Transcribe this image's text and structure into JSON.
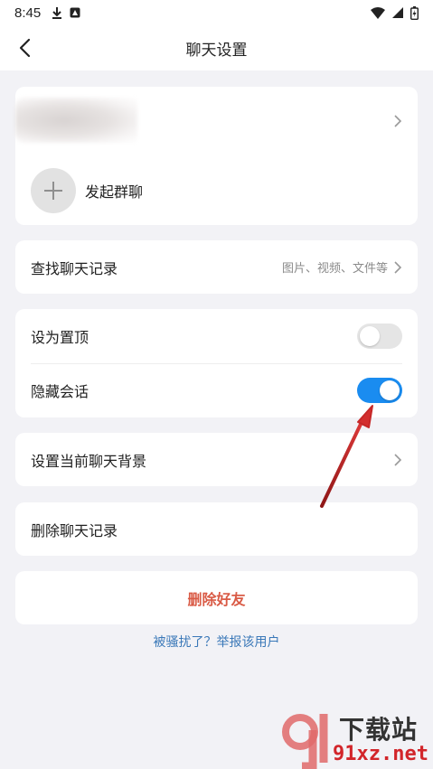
{
  "status_bar": {
    "time": "8:45"
  },
  "header": {
    "title": "聊天设置"
  },
  "group_section": {
    "start_group_label": "发起群聊"
  },
  "search_section": {
    "find_records_label": "查找聊天记录",
    "find_records_hint": "图片、视频、文件等"
  },
  "toggles_section": {
    "pin_label": "设为置顶",
    "pin_enabled": false,
    "hide_label": "隐藏会话",
    "hide_enabled": true
  },
  "background_section": {
    "set_background_label": "设置当前聊天背景"
  },
  "delete_records_section": {
    "delete_records_label": "删除聊天记录"
  },
  "danger_section": {
    "delete_friend_label": "删除好友"
  },
  "report_link": "被骚扰了？举报该用户",
  "watermark": {
    "text": "下载站",
    "url": "91xz.net"
  },
  "colors": {
    "toggle_on": "#1a8cf0",
    "danger_text": "#d95a45",
    "link_text": "#3a78b8",
    "annotation_arrow": "#c62828"
  }
}
